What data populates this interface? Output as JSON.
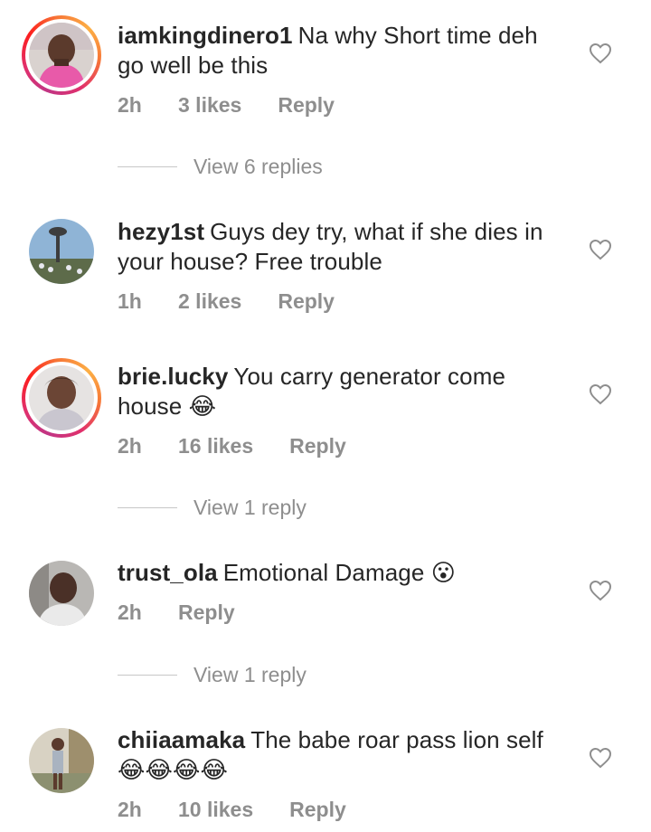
{
  "comments": [
    {
      "username": "iamkingdinero1",
      "text": "Na why Short time deh go well be this",
      "time": "2h",
      "likes": "3 likes",
      "reply_label": "Reply",
      "view_replies": "View 6 replies",
      "avatar_icon": "profile-photo-icon",
      "story_ring": true
    },
    {
      "username": "hezy1st",
      "text": "Guys dey try, what if she dies in your house? Free trouble",
      "time": "1h",
      "likes": "2 likes",
      "reply_label": "Reply",
      "avatar_icon": "profile-photo-icon",
      "story_ring": false
    },
    {
      "username": "brie.lucky",
      "text": "You carry generator come house",
      "emoji": "😂",
      "time": "2h",
      "likes": "16 likes",
      "reply_label": "Reply",
      "view_replies": "View 1 reply",
      "avatar_icon": "profile-photo-icon",
      "story_ring": true
    },
    {
      "username": "trust_ola",
      "text": "Emotional Damage",
      "emoji": "😮",
      "time": "2h",
      "reply_label": "Reply",
      "view_replies": "View 1 reply",
      "avatar_icon": "profile-photo-icon",
      "story_ring": false
    },
    {
      "username": "chiiaamaka",
      "text": "The babe roar pass lion self",
      "emoji": "😂😂😂😂",
      "time": "2h",
      "likes": "10 likes",
      "reply_label": "Reply",
      "avatar_icon": "profile-photo-icon",
      "story_ring": false
    }
  ],
  "icons": {
    "like": "heart-outline-icon"
  },
  "colors": {
    "text": "#262626",
    "secondary": "#8e8e8e",
    "divider": "#c7c7c7"
  }
}
